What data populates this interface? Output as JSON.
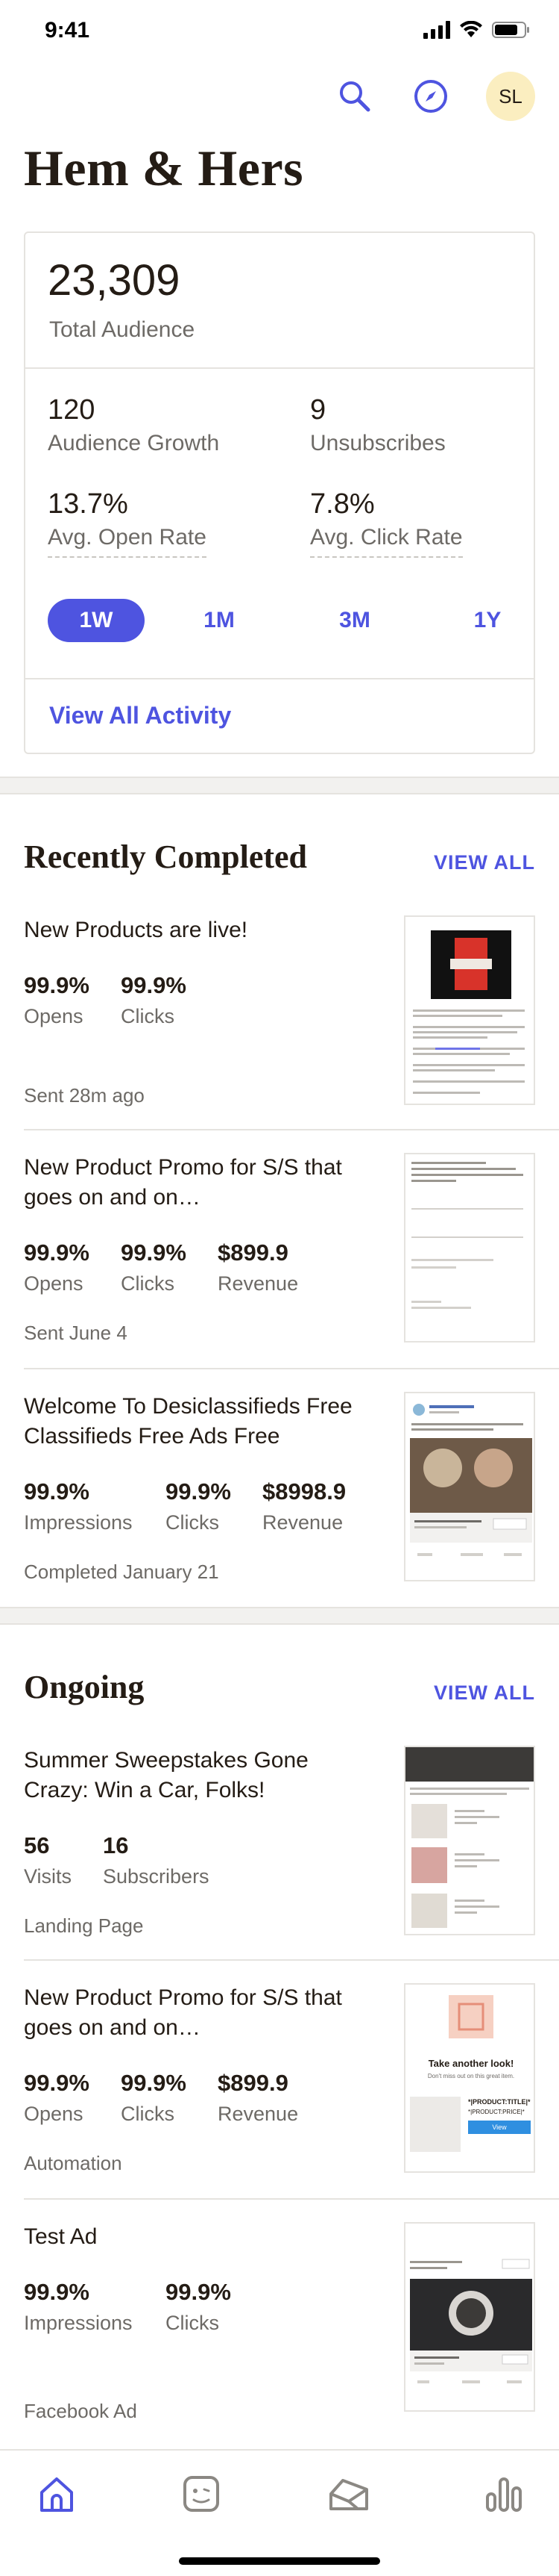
{
  "status": {
    "time": "9:41"
  },
  "header": {
    "title": "Hem & Hers",
    "avatar_initials": "SL"
  },
  "stats": {
    "total_value": "23,309",
    "total_label": "Total Audience",
    "growth_value": "120",
    "growth_label": "Audience Growth",
    "unsub_value": "9",
    "unsub_label": "Unsubscribes",
    "open_value": "13.7%",
    "open_label": "Avg. Open Rate",
    "click_value": "7.8%",
    "click_label": "Avg. Click Rate",
    "ranges": [
      "1W",
      "1M",
      "3M",
      "1Y"
    ],
    "active_range": "1W",
    "view_activity": "View All Activity"
  },
  "recent": {
    "title": "Recently Completed",
    "view_all": "VIEW ALL",
    "items": [
      {
        "title": "New Products are live!",
        "metrics": [
          {
            "value": "99.9%",
            "label": "Opens"
          },
          {
            "value": "99.9%",
            "label": "Clicks"
          }
        ],
        "meta": "Sent 28m ago"
      },
      {
        "title": "New Product Promo for S/S that goes on and on…",
        "metrics": [
          {
            "value": "99.9%",
            "label": "Opens"
          },
          {
            "value": "99.9%",
            "label": "Clicks"
          },
          {
            "value": "$899.9",
            "label": "Revenue"
          }
        ],
        "meta": "Sent June 4"
      },
      {
        "title": "Welcome To Desiclassifieds Free Classifieds Free Ads Free",
        "metrics": [
          {
            "value": "99.9%",
            "label": "Impressions"
          },
          {
            "value": "99.9%",
            "label": "Clicks"
          },
          {
            "value": "$8998.9",
            "label": "Revenue"
          }
        ],
        "meta": "Completed January 21"
      }
    ]
  },
  "ongoing": {
    "title": "Ongoing",
    "view_all": "VIEW ALL",
    "items": [
      {
        "title": "Summer Sweepstakes Gone Crazy: Win a Car, Folks!",
        "metrics": [
          {
            "value": "56",
            "label": "Visits"
          },
          {
            "value": "16",
            "label": "Subscribers"
          }
        ],
        "meta": "Landing Page"
      },
      {
        "title": "New Product Promo for S/S that goes on and on…",
        "metrics": [
          {
            "value": "99.9%",
            "label": "Opens"
          },
          {
            "value": "99.9%",
            "label": "Clicks"
          },
          {
            "value": "$899.9",
            "label": "Revenue"
          }
        ],
        "meta": "Automation"
      },
      {
        "title": "Test Ad",
        "metrics": [
          {
            "value": "99.9%",
            "label": "Impressions"
          },
          {
            "value": "99.9%",
            "label": "Clicks"
          }
        ],
        "meta": "Facebook Ad"
      }
    ]
  },
  "thumbs": {
    "take_another_look": "Take another look!",
    "dont_miss": "Don't miss out on this great item.",
    "product_title": "*|PRODUCT:TITLE|*",
    "product_price": "*|PRODUCT:PRICE|*",
    "view_btn": "View"
  },
  "tabs": [
    "home-tab",
    "audience-tab",
    "campaigns-tab",
    "reports-tab"
  ],
  "colors": {
    "accent": "#4e54e0",
    "text": "#241c15",
    "muted": "#6d6a66",
    "border": "#e5e3df",
    "avatar_bg": "#fbeec0"
  }
}
